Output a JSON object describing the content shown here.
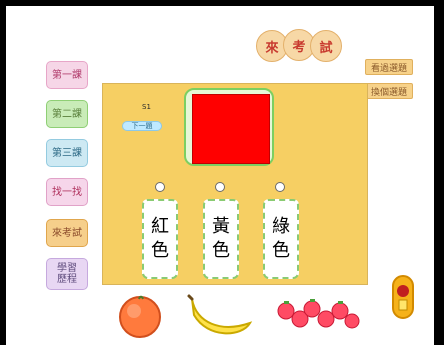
{
  "header": {
    "title_chars": [
      "來",
      "考",
      "試"
    ]
  },
  "sidebar": {
    "items": [
      {
        "label": "第一課"
      },
      {
        "label": "第二課"
      },
      {
        "label": "第三課"
      },
      {
        "label": "找一找"
      },
      {
        "label": "來考試"
      },
      {
        "label_line1": "學習",
        "label_line2": "歷程"
      }
    ]
  },
  "top_links": {
    "review": "看過選題",
    "next": "換個選題"
  },
  "quiz": {
    "counter": "S1",
    "pill_label": "下一題",
    "color_hex": "#ff0000",
    "options": [
      {
        "line1": "紅",
        "line2": "色"
      },
      {
        "line1": "黃",
        "line2": "色"
      },
      {
        "line1": "綠",
        "line2": "色"
      }
    ]
  },
  "footer": {
    "items": [
      "orange-icon",
      "banana-icon",
      "strawberries-icon",
      "speaker-icon"
    ]
  }
}
